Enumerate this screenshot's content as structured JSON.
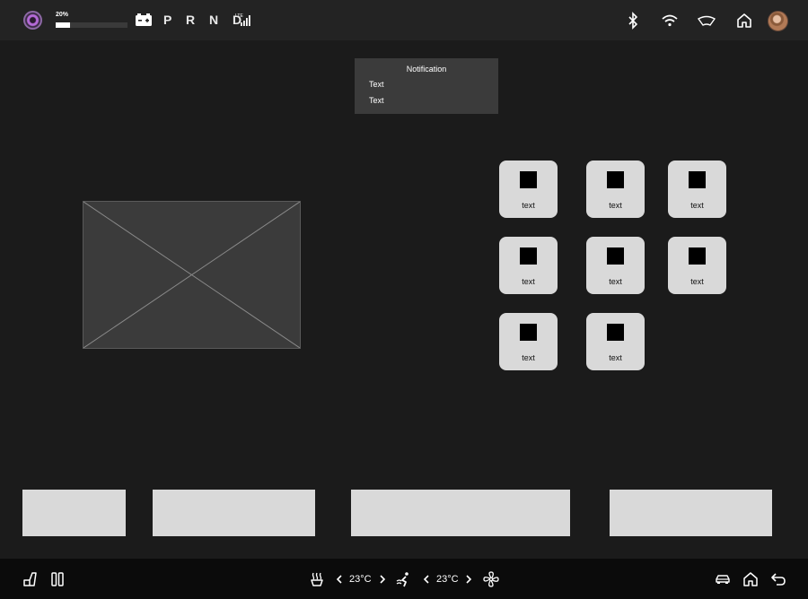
{
  "status_bar": {
    "battery_percent_label": "20%",
    "battery_level": 0.2,
    "gear_selector": "P R N D",
    "signal_label": "LTE"
  },
  "notification": {
    "title": "Notification",
    "lines": [
      "Text",
      "Text"
    ]
  },
  "app_grid": {
    "tiles": [
      {
        "label": "text"
      },
      {
        "label": "text"
      },
      {
        "label": "text"
      },
      {
        "label": "text"
      },
      {
        "label": "text"
      },
      {
        "label": "text"
      },
      {
        "label": "text"
      },
      {
        "label": "text"
      }
    ]
  },
  "bottom_bar": {
    "left_temp": "23°C",
    "right_temp": "23°C"
  },
  "icons": {
    "top_right": [
      "bluetooth-icon",
      "wifi-icon",
      "windshield-icon",
      "home-icon",
      "avatar"
    ],
    "bottom_left": [
      "seat-icon",
      "split-view-icon"
    ],
    "bottom_center": [
      "heated-seat-icon",
      "chevron-left-icon",
      "chevron-right-icon",
      "airflow-icon",
      "fan-icon"
    ],
    "bottom_right": [
      "car-icon",
      "home-icon",
      "back-icon"
    ]
  },
  "colors": {
    "background": "#1b1b1b",
    "topbar": "#232323",
    "bottombar": "#0b0b0b",
    "tile": "#d9d9d9"
  }
}
